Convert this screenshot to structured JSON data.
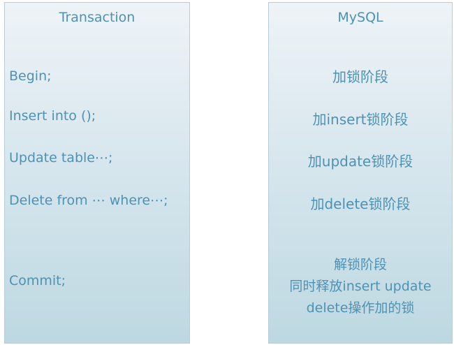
{
  "transaction": {
    "title": "Transaction",
    "steps": [
      "Begin;",
      "Insert into ();",
      "Update table⋯;",
      "Delete from ⋯ where⋯;",
      "Commit;"
    ]
  },
  "mysql": {
    "title": "MySQL",
    "phases": [
      "加锁阶段",
      "加insert锁阶段",
      "加update锁阶段",
      "加delete锁阶段"
    ],
    "unlock": {
      "line1": "解锁阶段",
      "line2": "同时释放insert update",
      "line3": "delete操作加的锁"
    }
  }
}
